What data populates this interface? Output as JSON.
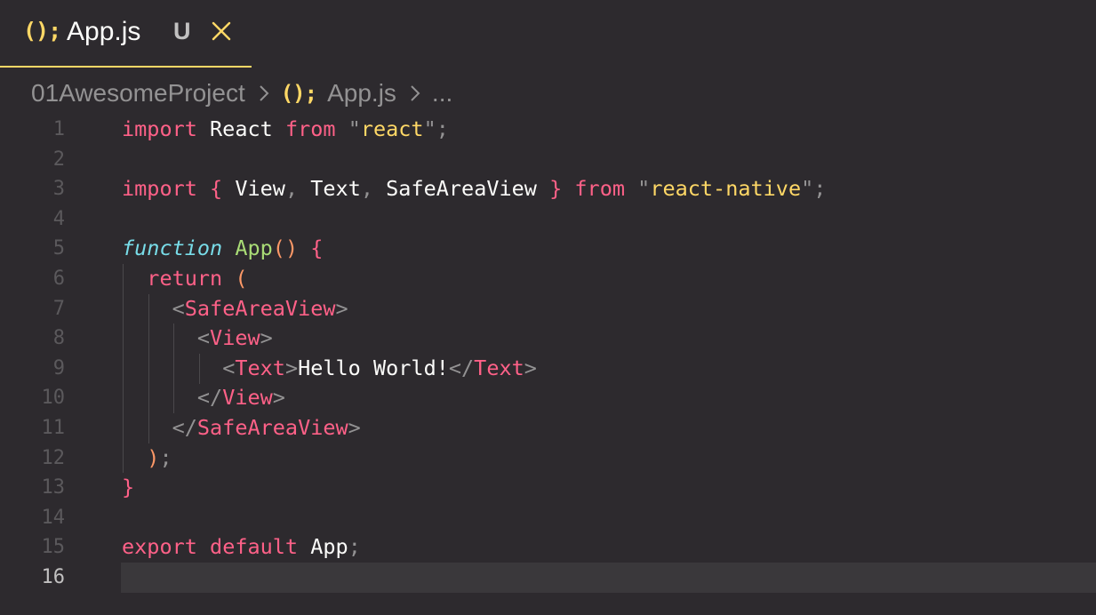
{
  "tab": {
    "icon": "();",
    "label": "App.js",
    "status": "U",
    "close_icon": "close-icon"
  },
  "breadcrumb": {
    "folder": "01AwesomeProject",
    "file_icon": "();",
    "file": "App.js",
    "more": "..."
  },
  "editor": {
    "current_line": 16,
    "line_numbers": [
      "1",
      "2",
      "3",
      "4",
      "5",
      "6",
      "7",
      "8",
      "9",
      "10",
      "11",
      "12",
      "13",
      "14",
      "15",
      "16"
    ],
    "lines": [
      [
        [
          "kw",
          "import"
        ],
        [
          "id",
          " React "
        ],
        [
          "kw",
          "from"
        ],
        [
          "id",
          " "
        ],
        [
          "q",
          "\""
        ],
        [
          "str",
          "react"
        ],
        [
          "q",
          "\""
        ],
        [
          "punc",
          ";"
        ]
      ],
      [],
      [
        [
          "kw",
          "import"
        ],
        [
          "id",
          " "
        ],
        [
          "brace",
          "{"
        ],
        [
          "id",
          " View"
        ],
        [
          "punc",
          ","
        ],
        [
          "id",
          " Text"
        ],
        [
          "punc",
          ","
        ],
        [
          "id",
          " SafeAreaView "
        ],
        [
          "brace",
          "}"
        ],
        [
          "id",
          " "
        ],
        [
          "kw",
          "from"
        ],
        [
          "id",
          " "
        ],
        [
          "q",
          "\""
        ],
        [
          "str",
          "react-native"
        ],
        [
          "q",
          "\""
        ],
        [
          "punc",
          ";"
        ]
      ],
      [],
      [
        [
          "fn-kw",
          "function"
        ],
        [
          "id",
          " "
        ],
        [
          "fn-name",
          "App"
        ],
        [
          "paren",
          "()"
        ],
        [
          "id",
          " "
        ],
        [
          "brace",
          "{"
        ]
      ],
      [
        [
          "id",
          "  "
        ],
        [
          "kw",
          "return"
        ],
        [
          "id",
          " "
        ],
        [
          "paren",
          "("
        ]
      ],
      [
        [
          "id",
          "    "
        ],
        [
          "ang",
          "<"
        ],
        [
          "tag",
          "SafeAreaView"
        ],
        [
          "ang",
          ">"
        ]
      ],
      [
        [
          "id",
          "      "
        ],
        [
          "ang",
          "<"
        ],
        [
          "tag",
          "View"
        ],
        [
          "ang",
          ">"
        ]
      ],
      [
        [
          "id",
          "        "
        ],
        [
          "ang",
          "<"
        ],
        [
          "tag",
          "Text"
        ],
        [
          "ang",
          ">"
        ],
        [
          "id",
          "Hello World!"
        ],
        [
          "ang",
          "</"
        ],
        [
          "tag",
          "Text"
        ],
        [
          "ang",
          ">"
        ]
      ],
      [
        [
          "id",
          "      "
        ],
        [
          "ang",
          "</"
        ],
        [
          "tag",
          "View"
        ],
        [
          "ang",
          ">"
        ]
      ],
      [
        [
          "id",
          "    "
        ],
        [
          "ang",
          "</"
        ],
        [
          "tag",
          "SafeAreaView"
        ],
        [
          "ang",
          ">"
        ]
      ],
      [
        [
          "id",
          "  "
        ],
        [
          "paren",
          ")"
        ],
        [
          "punc",
          ";"
        ]
      ],
      [
        [
          "brace",
          "}"
        ]
      ],
      [],
      [
        [
          "kw",
          "export"
        ],
        [
          "id",
          " "
        ],
        [
          "kw",
          "default"
        ],
        [
          "id",
          " App"
        ],
        [
          "punc",
          ";"
        ]
      ],
      []
    ]
  },
  "colors": {
    "background": "#2d2a2e",
    "accent_yellow": "#ffd866",
    "keyword_pink": "#ff6188",
    "function_cyan": "#78dce8",
    "function_green": "#a9dc76",
    "paren_orange": "#fc9867"
  }
}
